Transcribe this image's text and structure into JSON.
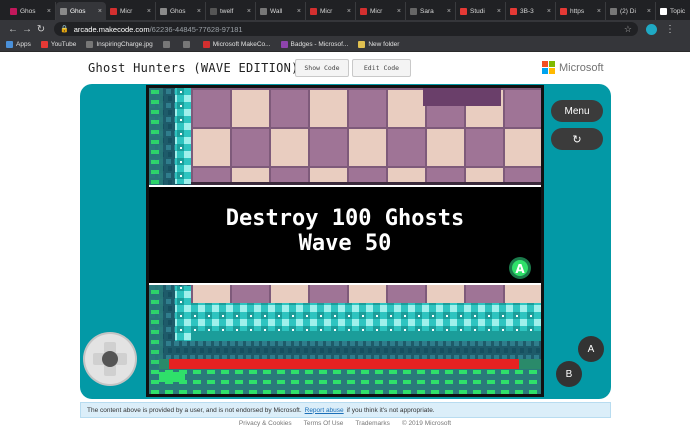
{
  "browser": {
    "tabs": [
      {
        "title": "Ghos",
        "fav": "#c2185b"
      },
      {
        "title": "Ghos",
        "fav": "#8a8a8a",
        "active": true
      },
      {
        "title": "Micr",
        "fav": "#d32f2f"
      },
      {
        "title": "Ghos",
        "fav": "#8a8a8a"
      },
      {
        "title": "twelf",
        "fav": "#555555"
      },
      {
        "title": "Wall",
        "fav": "#777777"
      },
      {
        "title": "Micr",
        "fav": "#d32f2f"
      },
      {
        "title": "Micr",
        "fav": "#d32f2f"
      },
      {
        "title": "Sara",
        "fav": "#666666"
      },
      {
        "title": "Studi",
        "fav": "#e53935"
      },
      {
        "title": "3B-3",
        "fav": "#e53935"
      },
      {
        "title": "https",
        "fav": "#e53935"
      },
      {
        "title": "(2) Di",
        "fav": "#777777"
      },
      {
        "title": "Topic",
        "fav": "#ffffff"
      }
    ],
    "url_host": "arcade.makecode.com",
    "url_path": "/62236-44845-77628-97181",
    "bookmarks": [
      {
        "label": "Apps",
        "fav": "#4a90d9"
      },
      {
        "label": "YouTube",
        "fav": "#e53935"
      },
      {
        "label": "InspiringCharge.jpg",
        "fav": "#777777"
      },
      {
        "label": "",
        "fav": "#777777"
      },
      {
        "label": "",
        "fav": "#777777"
      },
      {
        "label": "Microsoft MakeCo...",
        "fav": "#d32f2f"
      },
      {
        "label": "Badges - Microsof...",
        "fav": "#8e44ad"
      },
      {
        "label": "New folder",
        "fav": "#e0c050"
      }
    ]
  },
  "page": {
    "title": "Ghost Hunters (WAVE EDITION)",
    "show_code_label": "Show Code",
    "edit_code_label": "Edit Code",
    "brand": "Microsoft",
    "brand_colors": [
      "#f25022",
      "#7fba00",
      "#00a4ef",
      "#ffb900"
    ]
  },
  "game": {
    "message_line1": "Destroy 100 Ghosts",
    "message_line2": "Wave 50",
    "a_badge": "A",
    "menu_label": "Menu",
    "a_button": "A",
    "b_button": "B"
  },
  "notice": {
    "before": "The content above is provided by a user, and is not endorsed by Microsoft.",
    "link": "Report abuse",
    "after": "if you think it's not appropriate."
  },
  "footer": {
    "links": [
      "Privacy & Cookies",
      "Terms Of Use",
      "Trademarks",
      "© 2019 Microsoft"
    ]
  }
}
